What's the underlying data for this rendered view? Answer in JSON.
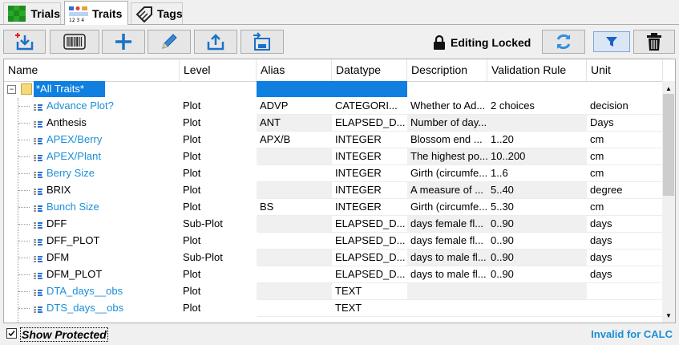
{
  "tabs": [
    {
      "label": "Trials",
      "icon": "trials-grid-icon"
    },
    {
      "label": "Traits",
      "icon": "traits-table-icon"
    },
    {
      "label": "Tags",
      "icon": "tag-icon"
    }
  ],
  "toolbar": {
    "lock_text": "Editing Locked",
    "buttons": [
      "import-button",
      "barcode-button",
      "add-button",
      "edit-button",
      "export-button",
      "save-button",
      "refresh-button",
      "filter-button",
      "delete-button"
    ]
  },
  "grid": {
    "columns": [
      "Name",
      "Level",
      "Alias",
      "Datatype",
      "Description",
      "Validation Rule",
      "Unit"
    ],
    "root_label": "*All Traits*",
    "rows": [
      {
        "name": "Advance Plot?",
        "link": true,
        "level": "Plot",
        "alias": "ADVP",
        "datatype": "CATEGORI...",
        "description": "Whether to Ad...",
        "rule": "2 choices",
        "unit": "decision"
      },
      {
        "name": "Anthesis",
        "link": false,
        "level": "Plot",
        "alias": "ANT",
        "datatype": "ELAPSED_D...",
        "description": "Number of day...",
        "rule": "",
        "unit": "Days"
      },
      {
        "name": "APEX/Berry",
        "link": true,
        "level": "Plot",
        "alias": "APX/B",
        "datatype": "INTEGER",
        "description": "Blossom end ...",
        "rule": "1..20",
        "unit": "cm"
      },
      {
        "name": "APEX/Plant",
        "link": true,
        "level": "Plot",
        "alias": "",
        "datatype": "INTEGER",
        "description": "The highest po...",
        "rule": "10..200",
        "unit": "cm"
      },
      {
        "name": "Berry Size",
        "link": true,
        "level": "Plot",
        "alias": "",
        "datatype": "INTEGER",
        "description": "Girth (circumfe...",
        "rule": "1..6",
        "unit": "cm"
      },
      {
        "name": "BRIX",
        "link": false,
        "level": "Plot",
        "alias": "",
        "datatype": "INTEGER",
        "description": "A measure of ...",
        "rule": "5..40",
        "unit": "degree"
      },
      {
        "name": "Bunch Size",
        "link": true,
        "level": "Plot",
        "alias": "BS",
        "datatype": "INTEGER",
        "description": "Girth (circumfe...",
        "rule": "5..30",
        "unit": "cm"
      },
      {
        "name": "DFF",
        "link": false,
        "level": "Sub-Plot",
        "alias": "",
        "datatype": "ELAPSED_D...",
        "description": "days female fl...",
        "rule": "0..90",
        "unit": "days"
      },
      {
        "name": "DFF_PLOT",
        "link": false,
        "level": "Plot",
        "alias": "",
        "datatype": "ELAPSED_D...",
        "description": "days female fl...",
        "rule": "0..90",
        "unit": "days"
      },
      {
        "name": "DFM",
        "link": false,
        "level": "Sub-Plot",
        "alias": "",
        "datatype": "ELAPSED_D...",
        "description": "days to male fl...",
        "rule": "0..90",
        "unit": "days"
      },
      {
        "name": "DFM_PLOT",
        "link": false,
        "level": "Plot",
        "alias": "",
        "datatype": "ELAPSED_D...",
        "description": "days to male fl...",
        "rule": "0..90",
        "unit": "days"
      },
      {
        "name": "DTA_days__obs",
        "link": true,
        "level": "Plot",
        "alias": "",
        "datatype": "TEXT",
        "description": "",
        "rule": "",
        "unit": ""
      },
      {
        "name": "DTS_days__obs",
        "link": true,
        "level": "Plot",
        "alias": "",
        "datatype": "TEXT",
        "description": "",
        "rule": "",
        "unit": ""
      }
    ]
  },
  "status": {
    "show_protected": "Show Protected",
    "show_protected_checked": true,
    "invalid_text": "Invalid for CALC"
  },
  "colors": {
    "link": "#1a8fd6",
    "selection": "#0f7fe0",
    "accent": "#1a8fd6"
  }
}
